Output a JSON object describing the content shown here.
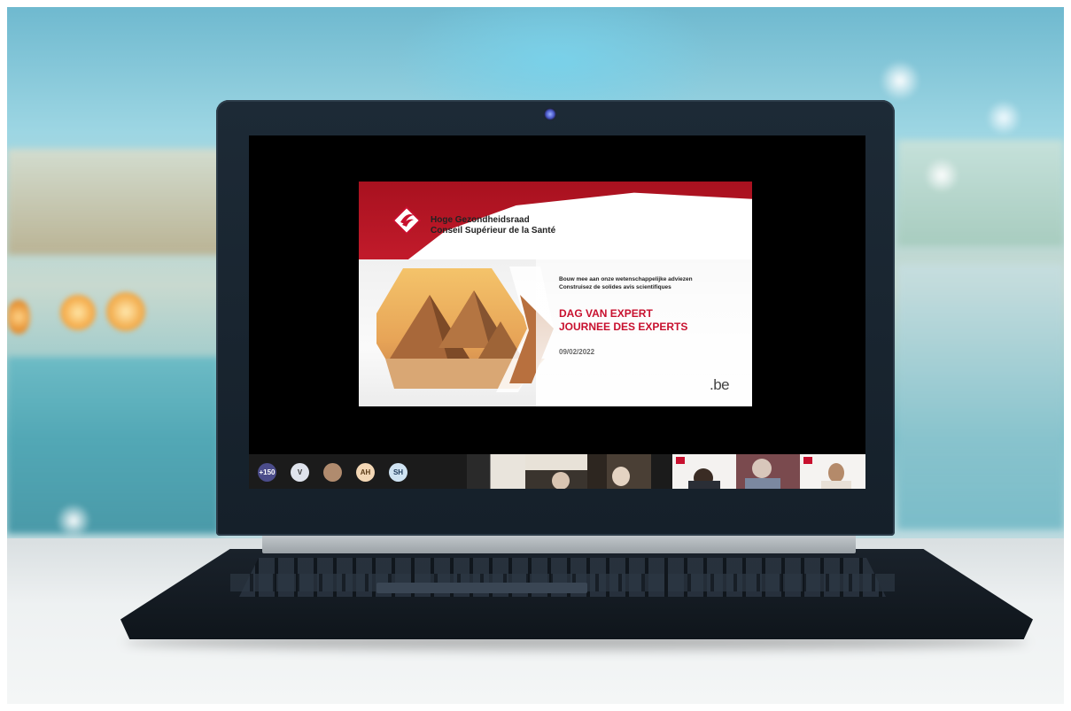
{
  "slide": {
    "org_line1": "Hoge Gezondheidsraad",
    "org_line2": "Conseil Supérieur de la Santé",
    "subtitle_nl": "Bouw mee aan onze wetenschappelijke adviezen",
    "subtitle_fr": "Construisez de solides avis scientifiques",
    "heading_nl": "DAG VAN EXPERT",
    "heading_fr": "JOURNEE DES EXPERTS",
    "date": "09/02/2022",
    "domain_mark": ".be",
    "accent_color": "#c8102e"
  },
  "meeting_bar": {
    "participants": [
      {
        "label": "+150",
        "bg": "#4b4c8a",
        "fg": "#ffffff"
      },
      {
        "label": "V",
        "bg": "#dfe3ec",
        "fg": "#333333"
      },
      {
        "label": "",
        "bg": "#b08b6e",
        "fg": "#ffffff"
      },
      {
        "label": "AH",
        "bg": "#f3d7b5",
        "fg": "#5a3b16"
      },
      {
        "label": "SH",
        "bg": "#cfe3f2",
        "fg": "#1e3a5a"
      }
    ],
    "video_tiles": 6
  }
}
